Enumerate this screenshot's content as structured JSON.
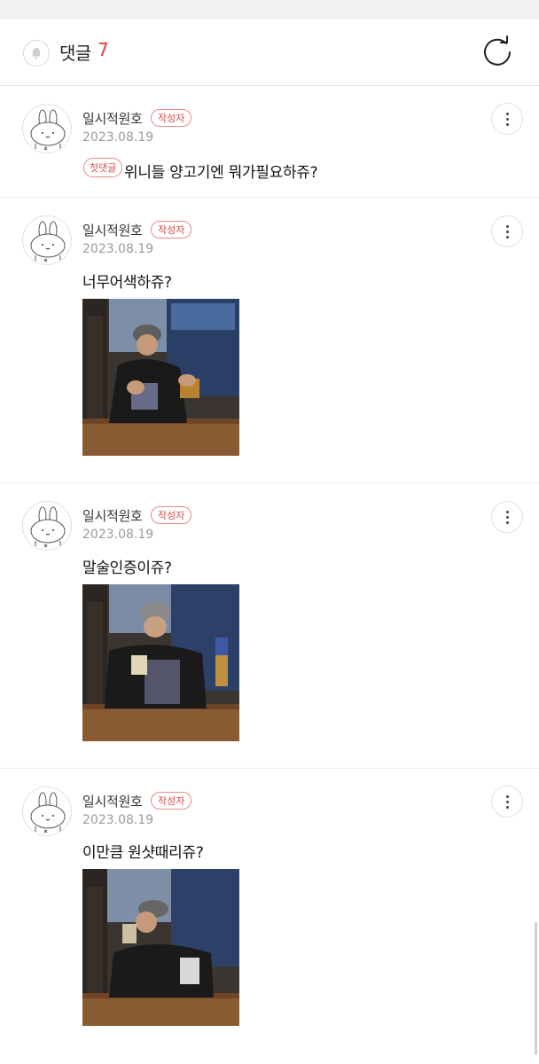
{
  "header": {
    "title": "댓글",
    "count": "7",
    "bell_icon": "bell-icon",
    "refresh_icon": "refresh-icon"
  },
  "colors": {
    "accent": "#e23b3b",
    "badge_border": "#e88a8a",
    "date_gray": "#9a9a9a",
    "divider": "#ececec"
  },
  "comments": [
    {
      "author": "일시적원호",
      "badge": "작성자",
      "date": "2023.08.19",
      "first_badge": "첫댓글",
      "text": "위니들 양고기엔 뭐가필요하쥬?",
      "avatar_icon": "bunny-avatar-icon",
      "more_icon": "more-vertical-icon"
    },
    {
      "author": "일시적원호",
      "badge": "작성자",
      "date": "2023.08.19",
      "text": "너무어색하쥬?",
      "avatar_icon": "bunny-avatar-icon",
      "more_icon": "more-vertical-icon",
      "photo_desc": "photo-man-pouring-beer"
    },
    {
      "author": "일시적원호",
      "badge": "작성자",
      "date": "2023.08.19",
      "text": "말술인증이쥬?",
      "avatar_icon": "bunny-avatar-icon",
      "more_icon": "more-vertical-icon",
      "photo_desc": "photo-man-laughing-with-bottle"
    },
    {
      "author": "일시적원호",
      "badge": "작성자",
      "date": "2023.08.19",
      "text": "이만큼 원샷때리쥬?",
      "avatar_icon": "bunny-avatar-icon",
      "more_icon": "more-vertical-icon",
      "photo_desc": "photo-man-drinking-glass"
    }
  ]
}
